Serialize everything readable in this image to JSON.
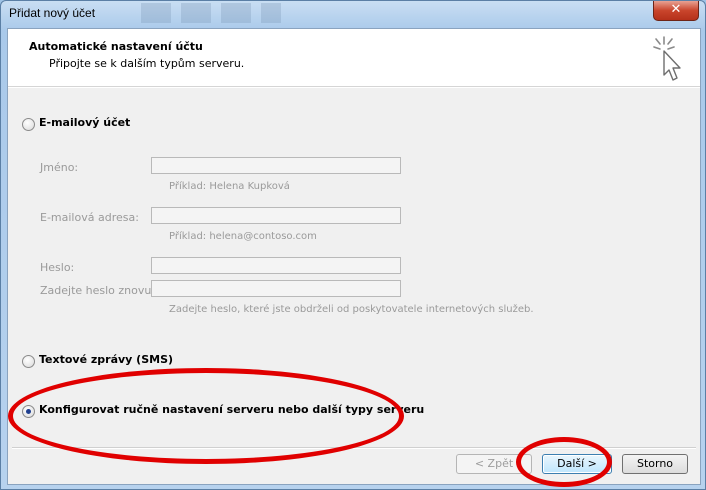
{
  "window": {
    "title": "Přidat nový účet",
    "close_label": "✕"
  },
  "header": {
    "title": "Automatické nastavení účtu",
    "subtitle": "Připojte se k dalším typům serveru."
  },
  "options": {
    "email_account": "E-mailový účet",
    "sms": "Textové zprávy (SMS)",
    "manual": "Konfigurovat ručně nastavení serveru nebo další typy serveru"
  },
  "form": {
    "name_label": "Jméno:",
    "name_hint": "Příklad: Helena Kupková",
    "email_label": "E-mailová adresa:",
    "email_hint": "Příklad: helena@contoso.com",
    "password_label": "Heslo:",
    "password_repeat_label": "Zadejte heslo znovu:",
    "password_hint": "Zadejte heslo, které jste obdrželi od poskytovatele internetových služeb."
  },
  "buttons": {
    "back": "< Zpět",
    "next": "Další >",
    "cancel": "Storno"
  },
  "colors": {
    "highlight": "#e00000",
    "selected_radio": "#1f3f8f"
  },
  "icons": {
    "wizard": "cursor-sparkle-icon"
  }
}
